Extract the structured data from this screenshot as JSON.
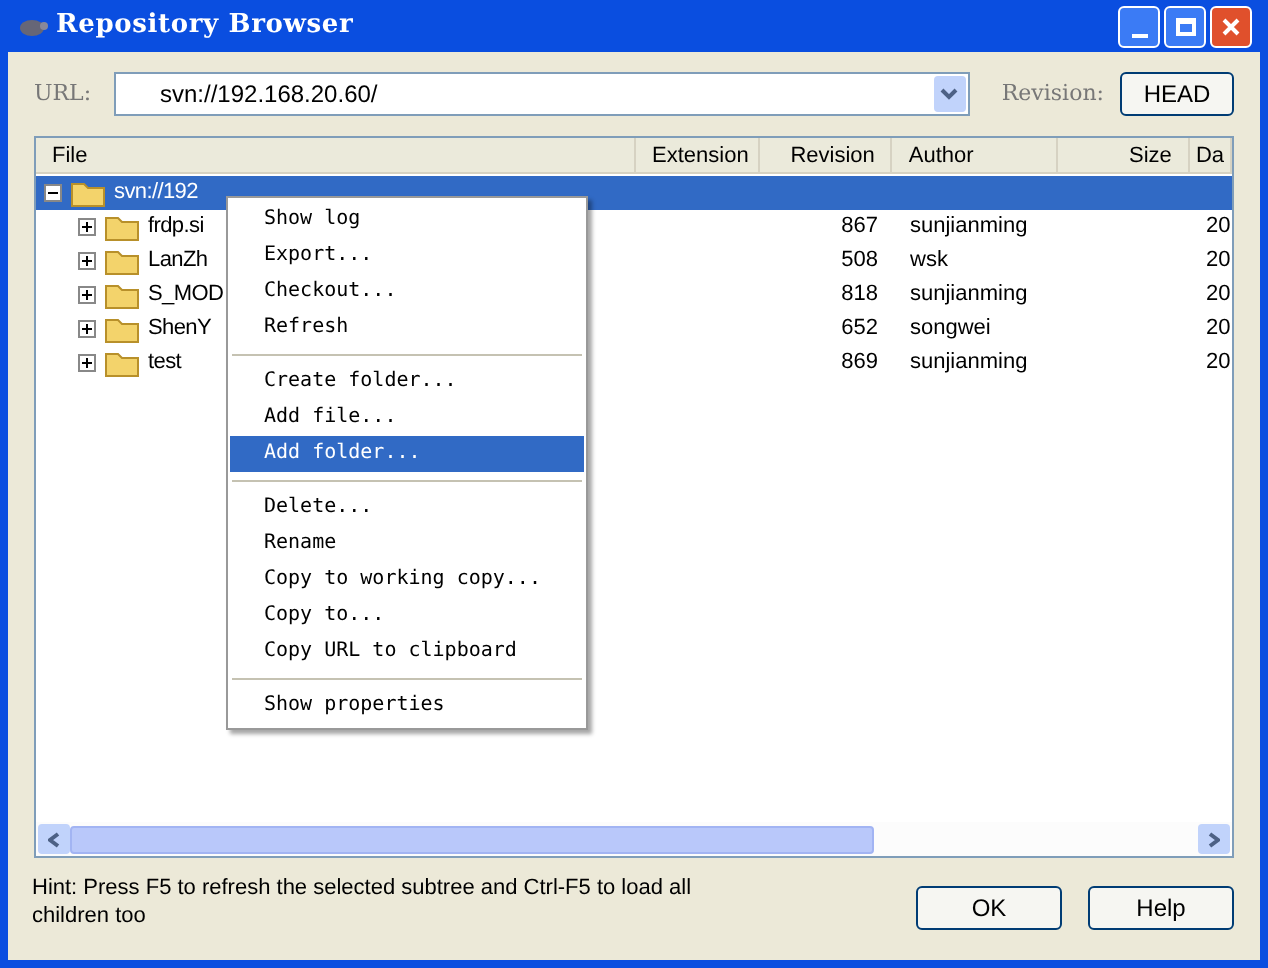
{
  "window": {
    "title": "Repository Browser"
  },
  "url_bar": {
    "label": "URL:",
    "value": "svn://192.168.20.60/",
    "revision_label": "Revision:",
    "revision_button": "HEAD"
  },
  "table": {
    "columns": [
      "File",
      "Extension",
      "Revision",
      "Author",
      "Size",
      "Da"
    ],
    "rows": [
      {
        "name": "svn://192",
        "expanded": true,
        "selected": true,
        "children": [
          {
            "name": "frdp.si",
            "expanded": false,
            "selected": false,
            "revision": "867",
            "author": "sunjianming",
            "date": "20"
          },
          {
            "name": "LanZh",
            "expanded": false,
            "selected": false,
            "revision": "508",
            "author": "wsk",
            "date": "20"
          },
          {
            "name": "S_MOD",
            "expanded": false,
            "selected": false,
            "revision": "818",
            "author": "sunjianming",
            "date": "20"
          },
          {
            "name": "ShenY",
            "expanded": false,
            "selected": false,
            "revision": "652",
            "author": "songwei",
            "date": "20"
          },
          {
            "name": "test",
            "expanded": false,
            "selected": false,
            "revision": "869",
            "author": "sunjianming",
            "date": "20"
          }
        ]
      }
    ]
  },
  "context_menu": {
    "groups": [
      [
        {
          "label": "Show log",
          "selected": false
        },
        {
          "label": "Export...",
          "selected": false
        },
        {
          "label": "Checkout...",
          "selected": false
        },
        {
          "label": "Refresh",
          "selected": false
        }
      ],
      [
        {
          "label": "Create folder...",
          "selected": false
        },
        {
          "label": "Add file...",
          "selected": false
        },
        {
          "label": "Add folder...",
          "selected": true
        }
      ],
      [
        {
          "label": "Delete...",
          "selected": false
        },
        {
          "label": "Rename",
          "selected": false
        },
        {
          "label": "Copy to working copy...",
          "selected": false
        },
        {
          "label": "Copy to...",
          "selected": false
        },
        {
          "label": "Copy URL to clipboard",
          "selected": false
        }
      ],
      [
        {
          "label": "Show properties",
          "selected": false
        }
      ]
    ]
  },
  "hint": "Hint: Press F5 to refresh the selected subtree and Ctrl-F5 to load all children too",
  "buttons": [
    "OK",
    "Help"
  ]
}
